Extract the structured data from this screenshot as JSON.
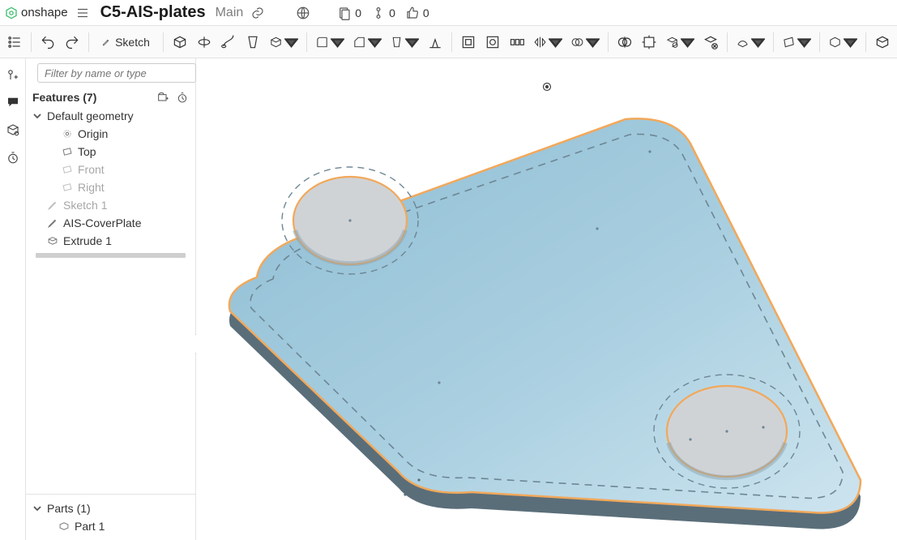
{
  "app": {
    "brand": "onshape",
    "document_title": "C5-AIS-plates",
    "branch": "Main"
  },
  "top_stats": {
    "versions": "0",
    "history": "0",
    "likes": "0"
  },
  "toolbar": {
    "sketch_label": "Sketch"
  },
  "filter": {
    "placeholder": "Filter by name or type"
  },
  "features": {
    "title": "Features (7)",
    "default_geometry_label": "Default geometry",
    "origin_label": "Origin",
    "top_plane_label": "Top",
    "front_plane_label": "Front",
    "right_plane_label": "Right",
    "sketch1_label": "Sketch 1",
    "ais_cover_label": "AIS-CoverPlate",
    "extrude1_label": "Extrude 1"
  },
  "parts": {
    "title": "Parts (1)",
    "part1_label": "Part 1"
  },
  "icons": {
    "logo": "onshape-logo",
    "menu": "hamburger",
    "link": "link",
    "globe": "globe",
    "versions": "versions",
    "history": "history",
    "like": "thumbs-up",
    "undo": "undo",
    "redo": "redo",
    "sketch": "pencil"
  },
  "colors": {
    "plate_top": "#9ec7db",
    "plate_top_light": "#bedbe9",
    "plate_edge_dark": "#5a6e79",
    "selection_edge": "#f2a85a",
    "hole_fill": "#d0d3d6"
  }
}
